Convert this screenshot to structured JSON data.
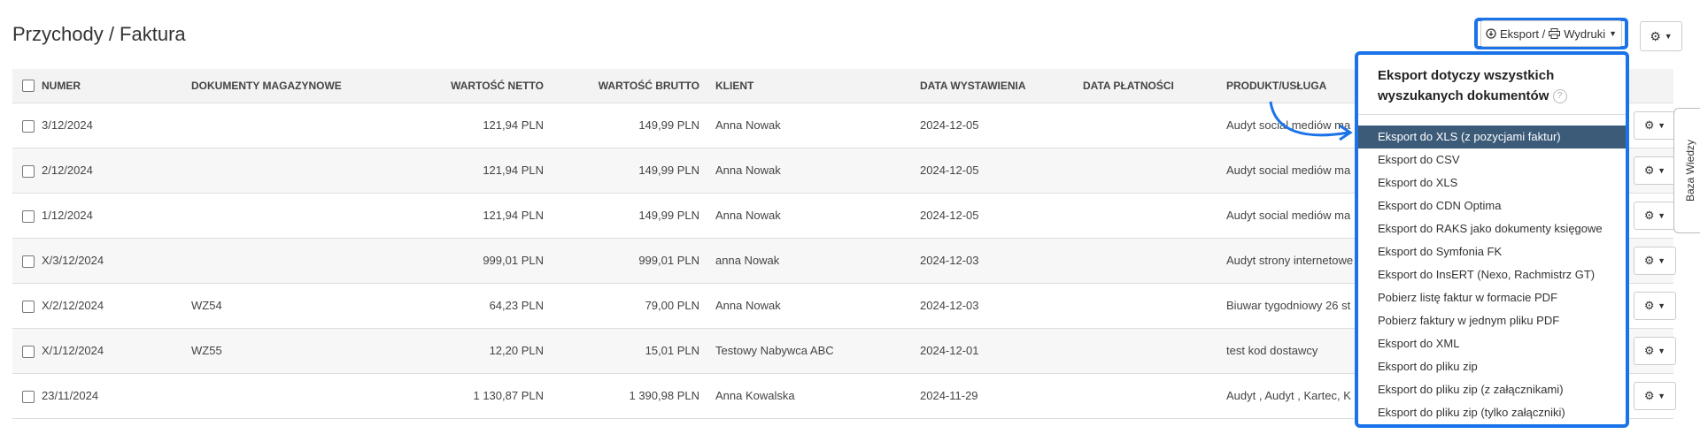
{
  "page": {
    "title": "Przychody / Faktura"
  },
  "toolbar": {
    "export_label": "Eksport / ",
    "print_label": "Wydruki",
    "export_icon": "download-circle-icon",
    "print_icon": "printer-icon",
    "settings_icon": "gear-icon"
  },
  "table": {
    "headers": {
      "numer": "NUMER",
      "dokumenty": "DOKUMENTY MAGAZYNOWE",
      "netto": "WARTOŚĆ NETTO",
      "brutto": "WARTOŚĆ BRUTTO",
      "klient": "KLIENT",
      "data_wyst": "DATA WYSTAWIENIA",
      "data_plat": "DATA PŁATNOŚCI",
      "produkt": "PRODUKT/USŁUGA"
    },
    "rows": [
      {
        "numer": "3/12/2024",
        "dok": "",
        "netto": "121,94 PLN",
        "brutto": "149,99 PLN",
        "klient": "Anna Nowak",
        "data": "2024-12-05",
        "produkt": "Audyt social mediów ma"
      },
      {
        "numer": "2/12/2024",
        "dok": "",
        "netto": "121,94 PLN",
        "brutto": "149,99 PLN",
        "klient": "Anna Nowak",
        "data": "2024-12-05",
        "produkt": "Audyt social mediów ma"
      },
      {
        "numer": "1/12/2024",
        "dok": "",
        "netto": "121,94 PLN",
        "brutto": "149,99 PLN",
        "klient": "Anna Nowak",
        "data": "2024-12-05",
        "produkt": "Audyt social mediów ma"
      },
      {
        "numer": "X/3/12/2024",
        "dok": "",
        "netto": "999,01 PLN",
        "brutto": "999,01 PLN",
        "klient": "anna Nowak",
        "data": "2024-12-03",
        "produkt": "Audyt strony internetowe"
      },
      {
        "numer": "X/2/12/2024",
        "dok": "WZ54",
        "netto": "64,23 PLN",
        "brutto": "79,00 PLN",
        "klient": "Anna Nowak",
        "data": "2024-12-03",
        "produkt": "Biuwar tygodniowy 26 st"
      },
      {
        "numer": "X/1/12/2024",
        "dok": "WZ55",
        "netto": "12,20 PLN",
        "brutto": "15,01 PLN",
        "klient": "Testowy Nabywca ABC",
        "data": "2024-12-01",
        "produkt": "test kod dostawcy"
      },
      {
        "numer": "23/11/2024",
        "dok": "",
        "netto": "1 130,87 PLN",
        "brutto": "1 390,98 PLN",
        "klient": "Anna Kowalska",
        "data": "2024-11-29",
        "produkt": "Audyt , Audyt , Kartec, K"
      }
    ]
  },
  "dropdown": {
    "header_line1": "Eksport dotyczy wszystkich",
    "header_line2": "wyszukanych dokumentów",
    "help": "?",
    "items": [
      "Eksport do XLS (z pozycjami faktur)",
      "Eksport do CSV",
      "Eksport do XLS",
      "Eksport do CDN Optima",
      "Eksport do RAKS jako dokumenty księgowe",
      "Eksport do Symfonia FK",
      "Eksport do InsERT (Nexo, Rachmistrz GT)",
      "Pobierz listę faktur w formacie PDF",
      "Pobierz faktury w jednym pliku PDF",
      "Eksport do XML",
      "Eksport do pliku zip",
      "Eksport do pliku zip (z załącznikami)",
      "Eksport do pliku zip (tylko załączniki)"
    ]
  },
  "side_tab": {
    "label": "Baza Wiedzy"
  }
}
